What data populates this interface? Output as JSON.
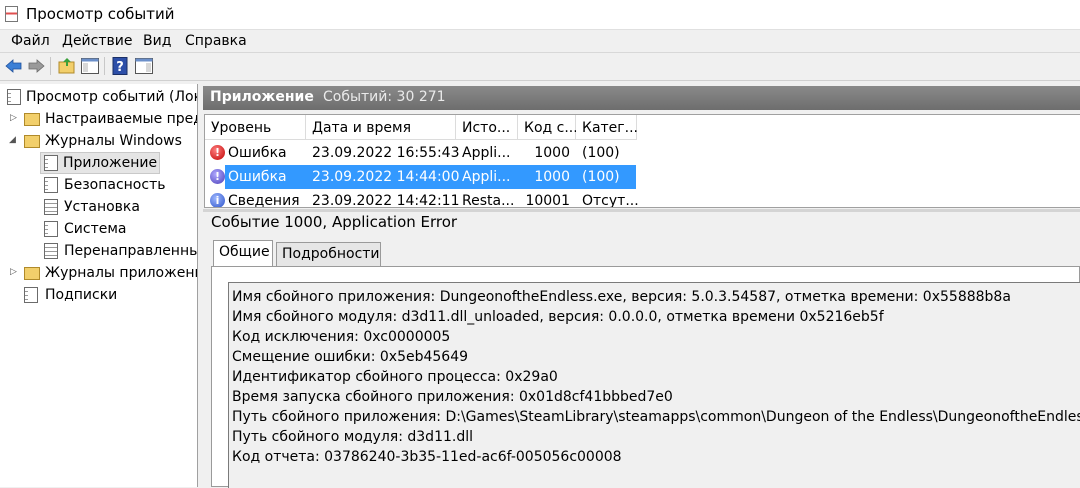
{
  "window": {
    "title": "Просмотр событий"
  },
  "menu": [
    "Файл",
    "Действие",
    "Вид",
    "Справка"
  ],
  "tree": {
    "root": "Просмотр событий (Лок",
    "custom_views": "Настраиваемые пред",
    "windows_logs": "Журналы Windows",
    "children": [
      "Приложение",
      "Безопасность",
      "Установка",
      "Система",
      "Перенаправленны"
    ],
    "app_logs": "Журналы приложени",
    "subscriptions": "Подписки"
  },
  "pane": {
    "title": "Приложение",
    "count": "Событий: 30 271"
  },
  "grid": {
    "columns": [
      "Уровень",
      "Дата и время",
      "Исто...",
      "Код с...",
      "Катег..."
    ],
    "rows": [
      {
        "level": "Ошибка",
        "date": "23.09.2022 16:55:43",
        "source": "Appli...",
        "code": "1000",
        "category": "(100)",
        "icon": "error-icon",
        "selected": false
      },
      {
        "level": "Ошибка",
        "date": "23.09.2022 14:44:00",
        "source": "Appli...",
        "code": "1000",
        "category": "(100)",
        "icon": "error-icon",
        "selected": true
      },
      {
        "level": "Сведения",
        "date": "23.09.2022 14:42:11",
        "source": "Resta...",
        "code": "10001",
        "category": "Отсут...",
        "icon": "info-icon",
        "selected": false
      }
    ]
  },
  "detail": {
    "title": "Событие 1000, Application Error",
    "tabs": [
      "Общие",
      "Подробности"
    ],
    "lines": [
      "Имя сбойного приложения: DungeonoftheEndless.exe, версия: 5.0.3.54587, отметка времени: 0x55888b8a",
      "Имя сбойного модуля: d3d11.dll_unloaded, версия: 0.0.0.0, отметка времени 0x5216eb5f",
      "Код исключения: 0xc0000005",
      "Смещение ошибки: 0x5eb45649",
      "Идентификатор сбойного процесса: 0x29a0",
      "Время запуска сбойного приложения: 0x01d8cf41bbbed7e0",
      "Путь сбойного приложения: D:\\Games\\SteamLibrary\\steamapps\\common\\Dungeon of the Endless\\DungeonoftheEndless.exe",
      "Путь сбойного модуля: d3d11.dll",
      "Код отчета: 03786240-3b35-11ed-ac6f-005056c00008"
    ]
  },
  "colors": {
    "selection": "#3399ff",
    "header": "#7a7a7a"
  }
}
